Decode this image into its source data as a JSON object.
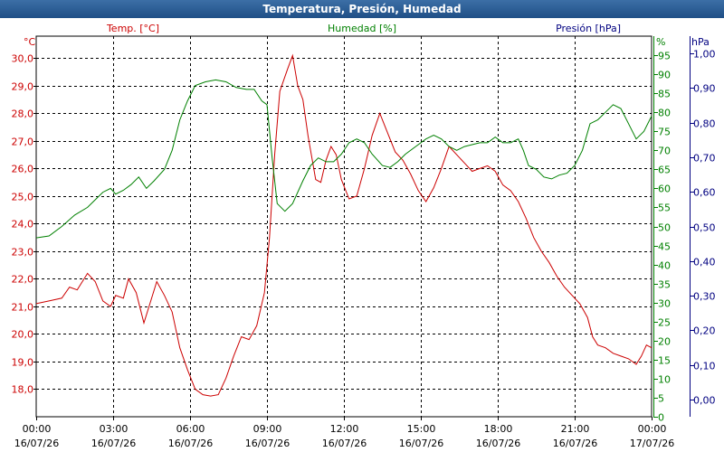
{
  "window": {
    "title": "Temperatura, Presión, Humedad"
  },
  "chart_data": {
    "type": "line",
    "title": "Temperatura, Presión, Humedad",
    "x_ticks": [
      {
        "time": "00:00",
        "date": "16/07/26"
      },
      {
        "time": "03:00",
        "date": "16/07/26"
      },
      {
        "time": "06:00",
        "date": "16/07/26"
      },
      {
        "time": "09:00",
        "date": "16/07/26"
      },
      {
        "time": "12:00",
        "date": "16/07/26"
      },
      {
        "time": "15:00",
        "date": "16/07/26"
      },
      {
        "time": "18:00",
        "date": "16/07/26"
      },
      {
        "time": "21:00",
        "date": "16/07/26"
      },
      {
        "time": "00:00",
        "date": "17/07/26"
      }
    ],
    "x_unit": "hours",
    "x_range": [
      0,
      24
    ],
    "axes": {
      "temperature": {
        "label": "Temp. [°C]",
        "unit": "°C",
        "color": "#cc0000",
        "range": [
          17.0,
          30.8
        ],
        "ticks": [
          "30,0",
          "29,0",
          "28,0",
          "27,0",
          "26,0",
          "25,0",
          "24,0",
          "23,0",
          "22,0",
          "21,0",
          "20,0",
          "19,0",
          "18,0"
        ]
      },
      "humidity": {
        "label": "Humedad [%]",
        "unit": "%",
        "color": "#008000",
        "range": [
          0,
          100
        ],
        "ticks": [
          "95",
          "90",
          "85",
          "80",
          "75",
          "70",
          "65",
          "60",
          "55",
          "50",
          "45",
          "40",
          "35",
          "30",
          "25",
          "20",
          "15",
          "10",
          "5",
          "0"
        ]
      },
      "pressure": {
        "label": "Presión [hPa]",
        "unit": "hPa",
        "color": "#000080",
        "range": [
          -0.05,
          1.05
        ],
        "ticks": [
          "1,00",
          "0,90",
          "0,80",
          "0,70",
          "0,60",
          "0,50",
          "0,40",
          "0,30",
          "0,20",
          "0,10",
          "0,00"
        ]
      }
    },
    "grid": true,
    "series": [
      {
        "name": "Temp. [°C]",
        "color": "#cc0000",
        "axis": "temperature",
        "points": [
          [
            0,
            21.1
          ],
          [
            0.5,
            21.2
          ],
          [
            1.0,
            21.3
          ],
          [
            1.3,
            21.7
          ],
          [
            1.6,
            21.6
          ],
          [
            2.0,
            22.2
          ],
          [
            2.3,
            21.9
          ],
          [
            2.6,
            21.2
          ],
          [
            2.9,
            21.0
          ],
          [
            3.1,
            21.4
          ],
          [
            3.4,
            21.3
          ],
          [
            3.6,
            22.0
          ],
          [
            3.9,
            21.5
          ],
          [
            4.2,
            20.4
          ],
          [
            4.4,
            21.0
          ],
          [
            4.7,
            21.9
          ],
          [
            5.0,
            21.4
          ],
          [
            5.3,
            20.8
          ],
          [
            5.6,
            19.5
          ],
          [
            5.9,
            18.7
          ],
          [
            6.2,
            18.0
          ],
          [
            6.5,
            17.8
          ],
          [
            6.8,
            17.75
          ],
          [
            7.1,
            17.8
          ],
          [
            7.4,
            18.4
          ],
          [
            7.7,
            19.2
          ],
          [
            8.0,
            19.9
          ],
          [
            8.3,
            19.8
          ],
          [
            8.6,
            20.3
          ],
          [
            8.9,
            21.5
          ],
          [
            9.1,
            23.5
          ],
          [
            9.3,
            26.5
          ],
          [
            9.5,
            28.8
          ],
          [
            9.8,
            29.6
          ],
          [
            10.0,
            30.1
          ],
          [
            10.2,
            29.0
          ],
          [
            10.4,
            28.5
          ],
          [
            10.6,
            27.2
          ],
          [
            10.9,
            25.6
          ],
          [
            11.1,
            25.5
          ],
          [
            11.3,
            26.3
          ],
          [
            11.5,
            26.8
          ],
          [
            11.7,
            26.5
          ],
          [
            11.9,
            25.6
          ],
          [
            12.2,
            24.9
          ],
          [
            12.5,
            25.0
          ],
          [
            12.8,
            26.0
          ],
          [
            13.1,
            27.2
          ],
          [
            13.4,
            28.0
          ],
          [
            13.7,
            27.3
          ],
          [
            14.0,
            26.6
          ],
          [
            14.3,
            26.3
          ],
          [
            14.6,
            25.8
          ],
          [
            14.9,
            25.2
          ],
          [
            15.2,
            24.8
          ],
          [
            15.5,
            25.3
          ],
          [
            15.8,
            26.0
          ],
          [
            16.1,
            26.8
          ],
          [
            16.4,
            26.5
          ],
          [
            16.7,
            26.2
          ],
          [
            17.0,
            25.9
          ],
          [
            17.3,
            26.0
          ],
          [
            17.6,
            26.1
          ],
          [
            17.9,
            25.9
          ],
          [
            18.2,
            25.4
          ],
          [
            18.5,
            25.2
          ],
          [
            18.8,
            24.8
          ],
          [
            19.1,
            24.2
          ],
          [
            19.4,
            23.5
          ],
          [
            19.7,
            23.0
          ],
          [
            20.0,
            22.6
          ],
          [
            20.3,
            22.1
          ],
          [
            20.6,
            21.7
          ],
          [
            20.9,
            21.4
          ],
          [
            21.2,
            21.1
          ],
          [
            21.5,
            20.6
          ],
          [
            21.7,
            19.9
          ],
          [
            21.9,
            19.6
          ],
          [
            22.2,
            19.5
          ],
          [
            22.5,
            19.3
          ],
          [
            22.8,
            19.2
          ],
          [
            23.1,
            19.1
          ],
          [
            23.4,
            18.9
          ],
          [
            23.6,
            19.2
          ],
          [
            23.8,
            19.6
          ],
          [
            24.0,
            19.5
          ]
        ]
      },
      {
        "name": "Humedad [%]",
        "color": "#008000",
        "axis": "humidity",
        "points": [
          [
            0,
            47
          ],
          [
            0.5,
            47.5
          ],
          [
            1.0,
            50
          ],
          [
            1.5,
            53
          ],
          [
            2.0,
            55
          ],
          [
            2.3,
            57
          ],
          [
            2.6,
            59
          ],
          [
            2.9,
            60
          ],
          [
            3.1,
            58.5
          ],
          [
            3.4,
            59.5
          ],
          [
            3.7,
            61
          ],
          [
            4.0,
            63
          ],
          [
            4.3,
            60
          ],
          [
            4.6,
            62
          ],
          [
            5.0,
            65
          ],
          [
            5.3,
            70
          ],
          [
            5.6,
            78
          ],
          [
            5.9,
            83
          ],
          [
            6.2,
            87
          ],
          [
            6.6,
            88
          ],
          [
            7.0,
            88.5
          ],
          [
            7.4,
            88
          ],
          [
            7.8,
            86.5
          ],
          [
            8.2,
            86
          ],
          [
            8.5,
            86
          ],
          [
            8.8,
            83
          ],
          [
            9.0,
            82
          ],
          [
            9.2,
            68
          ],
          [
            9.4,
            56
          ],
          [
            9.7,
            54
          ],
          [
            10.0,
            56
          ],
          [
            10.4,
            62
          ],
          [
            10.7,
            66
          ],
          [
            11.0,
            68
          ],
          [
            11.3,
            67
          ],
          [
            11.6,
            67
          ],
          [
            11.9,
            69
          ],
          [
            12.2,
            72
          ],
          [
            12.5,
            73
          ],
          [
            12.8,
            72
          ],
          [
            13.1,
            69
          ],
          [
            13.5,
            66
          ],
          [
            13.8,
            65.5
          ],
          [
            14.1,
            67
          ],
          [
            14.4,
            69
          ],
          [
            14.8,
            71
          ],
          [
            15.2,
            73
          ],
          [
            15.5,
            74
          ],
          [
            15.8,
            73
          ],
          [
            16.1,
            71
          ],
          [
            16.4,
            70
          ],
          [
            16.7,
            71
          ],
          [
            17.0,
            71.5
          ],
          [
            17.3,
            72
          ],
          [
            17.6,
            72
          ],
          [
            17.9,
            73.5
          ],
          [
            18.2,
            72
          ],
          [
            18.5,
            72
          ],
          [
            18.8,
            73
          ],
          [
            19.0,
            70
          ],
          [
            19.2,
            66
          ],
          [
            19.5,
            65
          ],
          [
            19.8,
            63
          ],
          [
            20.1,
            62.5
          ],
          [
            20.4,
            63.5
          ],
          [
            20.7,
            64
          ],
          [
            21.0,
            66
          ],
          [
            21.3,
            70
          ],
          [
            21.6,
            77
          ],
          [
            21.9,
            78
          ],
          [
            22.2,
            80
          ],
          [
            22.5,
            82
          ],
          [
            22.8,
            81
          ],
          [
            23.1,
            77
          ],
          [
            23.4,
            73
          ],
          [
            23.7,
            75
          ],
          [
            24.0,
            79
          ]
        ]
      }
    ]
  }
}
